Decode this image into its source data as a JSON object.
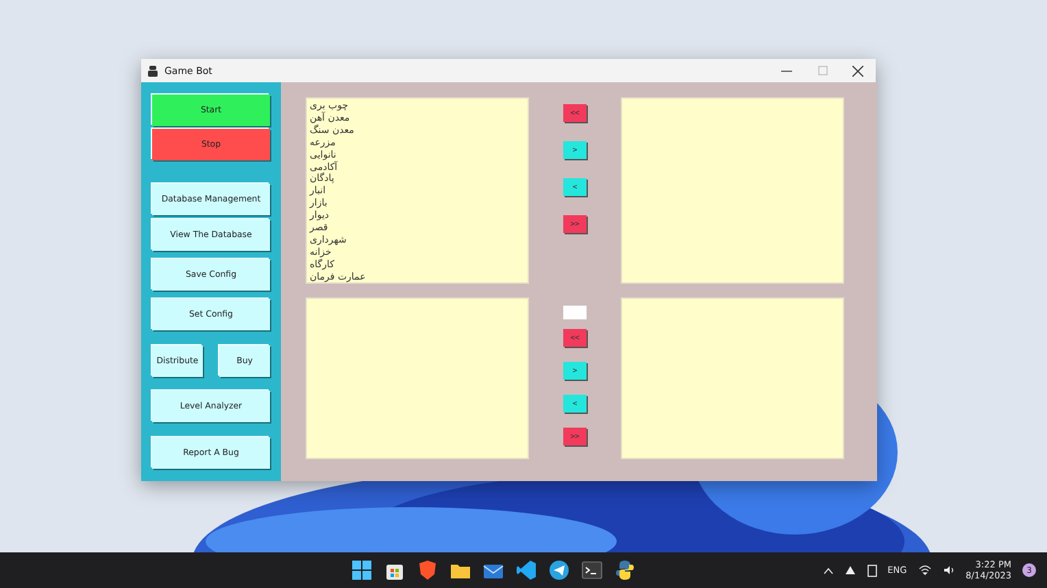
{
  "window": {
    "title": "Game Bot"
  },
  "sidebar": {
    "buttons": [
      {
        "label": "Start",
        "kind": "start"
      },
      {
        "label": "Stop",
        "kind": "stop"
      },
      {
        "label": "Database Management",
        "kind": "normal"
      },
      {
        "label": "View The Database",
        "kind": "normal"
      },
      {
        "label": "Save Config",
        "kind": "normal"
      },
      {
        "label": "Set Config",
        "kind": "normal"
      },
      {
        "label": "Distribute",
        "kind": "half"
      },
      {
        "label": "Buy",
        "kind": "half"
      },
      {
        "label": "Level Analyzer",
        "kind": "normal"
      },
      {
        "label": "Report A Bug",
        "kind": "normal"
      }
    ]
  },
  "top_panel": {
    "source_list": [
      "چوب بری",
      "معدن آهن",
      "معدن سنگ",
      "مزرعه",
      "نانوایی",
      "آکادمی",
      "پادگان",
      "انبار",
      "بازار",
      "دیوار",
      "قصر",
      "شهرداری",
      "خزانه",
      "کارگاه",
      "عمارت فرمان"
    ],
    "buttons": [
      {
        "label": "<<",
        "kind": "all"
      },
      {
        "label": ">",
        "kind": "one"
      },
      {
        "label": "<",
        "kind": "one"
      },
      {
        "label": ">>",
        "kind": "all"
      }
    ]
  },
  "bottom_panel": {
    "buttons": [
      {
        "label": "<<",
        "kind": "all"
      },
      {
        "label": ">",
        "kind": "one"
      },
      {
        "label": "<",
        "kind": "one"
      },
      {
        "label": ">>",
        "kind": "all"
      }
    ]
  },
  "taskbar": {
    "language": "ENG",
    "time": "3:22 PM",
    "date": "8/14/2023",
    "notification_count": "3"
  }
}
